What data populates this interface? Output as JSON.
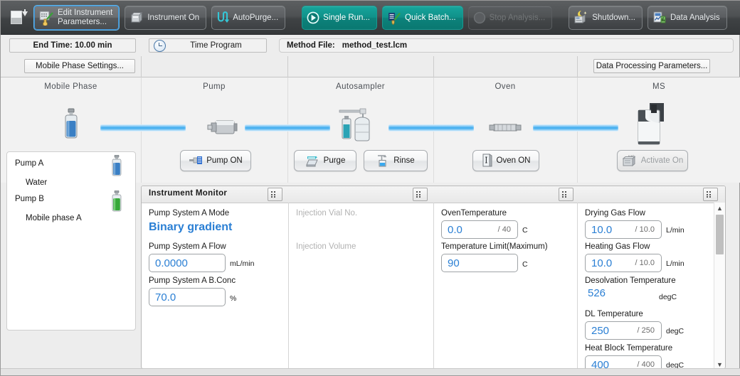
{
  "toolbar": {
    "left_icon": "panel-toggle-icon",
    "buttons": [
      {
        "name": "edit-instrument-parameters",
        "label_line1": "Edit Instrument",
        "label_line2": "Parameters...",
        "icon": "edit-parameters-icon",
        "state": "selected"
      },
      {
        "name": "instrument-on",
        "label_line1": "Instrument On",
        "label_line2": "",
        "icon": "instrument-icon",
        "state": "normal"
      },
      {
        "name": "auto-purge",
        "label_line1": "AutoPurge...",
        "label_line2": "",
        "icon": "autopurge-icon",
        "state": "normal"
      },
      {
        "name": "single-run",
        "label_line1": "Single Run...",
        "label_line2": "",
        "icon": "single-run-icon",
        "state": "teal"
      },
      {
        "name": "quick-batch",
        "label_line1": "Quick Batch...",
        "label_line2": "",
        "icon": "quick-batch-icon",
        "state": "teal"
      },
      {
        "name": "stop-analysis",
        "label_line1": "Stop Analysis...",
        "label_line2": "",
        "icon": "stop-analysis-icon",
        "state": "disabled"
      },
      {
        "name": "shutdown",
        "label_line1": "Shutdown...",
        "label_line2": "",
        "icon": "shutdown-icon",
        "state": "normal"
      },
      {
        "name": "data-analysis",
        "label_line1": "Data Analysis",
        "label_line2": "",
        "icon": "data-analysis-icon",
        "state": "normal"
      }
    ]
  },
  "infobar": {
    "end_time": "End Time: 10.00 min",
    "time_program": "Time Program",
    "time_program_icon": "clock-icon",
    "method_file_label": "Method File:",
    "method_file_value": "method_test.lcm"
  },
  "row2": {
    "mobile_phase_settings": "Mobile Phase Settings...",
    "data_processing_parameters": "Data Processing Parameters..."
  },
  "flow": {
    "stages": [
      "Mobile Phase",
      "Pump",
      "Autosampler",
      "Oven",
      "MS"
    ],
    "buttons": [
      {
        "name": "pump-on-button",
        "label": "Pump ON",
        "icon": "pump-icon",
        "disabled": false
      },
      {
        "name": "purge-button",
        "label": "Purge",
        "icon": "purge-icon",
        "disabled": false
      },
      {
        "name": "rinse-button",
        "label": "Rinse",
        "icon": "rinse-icon",
        "disabled": false
      },
      {
        "name": "oven-on-button",
        "label": "Oven ON",
        "icon": "oven-icon",
        "disabled": false
      },
      {
        "name": "activate-on-button",
        "label": "Activate On",
        "icon": "ms-activate-icon",
        "disabled": true
      }
    ]
  },
  "mobile_phase_panel": {
    "rows": [
      {
        "pump": "Pump A",
        "solvent": "Water",
        "bottle_color": "#3a7fc4"
      },
      {
        "pump": "Pump B",
        "solvent": "Mobile phase A",
        "bottle_color": "#37a83a"
      }
    ]
  },
  "monitor": {
    "title": "Instrument Monitor",
    "grid_icon": "grid-icon",
    "columns": [
      {
        "name": "pump-column",
        "fields": [
          {
            "label": "Pump System A Mode",
            "kind": "text-blue-bold",
            "value": "Binary gradient"
          },
          {
            "label": "Pump System A Flow",
            "kind": "box",
            "value": "0.0000",
            "setpoint": "",
            "unit": "mL/min"
          },
          {
            "label": "Pump System A B.Conc",
            "kind": "box",
            "value": "70.0",
            "setpoint": "",
            "unit": "%"
          }
        ]
      },
      {
        "name": "autosampler-column",
        "fields": [
          {
            "label": "Injection Vial No.",
            "kind": "dim"
          },
          {
            "label": "Injection Volume",
            "kind": "dim"
          }
        ]
      },
      {
        "name": "oven-column",
        "fields": [
          {
            "label": "OvenTemperature",
            "kind": "box",
            "value": "0.0",
            "setpoint": "/ 40",
            "unit": "C"
          },
          {
            "label": "Temperature Limit(Maximum)",
            "kind": "box",
            "value": "90",
            "setpoint": "",
            "unit": "C"
          }
        ]
      },
      {
        "name": "ms-column",
        "fields": [
          {
            "label": "Drying Gas Flow",
            "kind": "box",
            "value": "10.0",
            "setpoint": "/ 10.0",
            "unit": "L/min"
          },
          {
            "label": "Heating Gas Flow",
            "kind": "box",
            "value": "10.0",
            "setpoint": "/ 10.0",
            "unit": "L/min"
          },
          {
            "label": "Desolvation Temperature",
            "kind": "plain",
            "value": "526",
            "unit": "degC"
          },
          {
            "label": "DL Temperature",
            "kind": "box",
            "value": "250",
            "setpoint": "/ 250",
            "unit": "degC"
          },
          {
            "label": "Heat Block Temperature",
            "kind": "box",
            "value": "400",
            "setpoint": "/ 400",
            "unit": "degC"
          }
        ]
      }
    ],
    "scrollbar": {
      "up": "▲",
      "down": "▼"
    }
  },
  "colors": {
    "accent_blue": "#2a7fd4",
    "teal_button": "#109189",
    "selected_border": "#63b6ea",
    "toolbar_bg": "#4e5153",
    "pipe_blue": "#39a9ef"
  }
}
